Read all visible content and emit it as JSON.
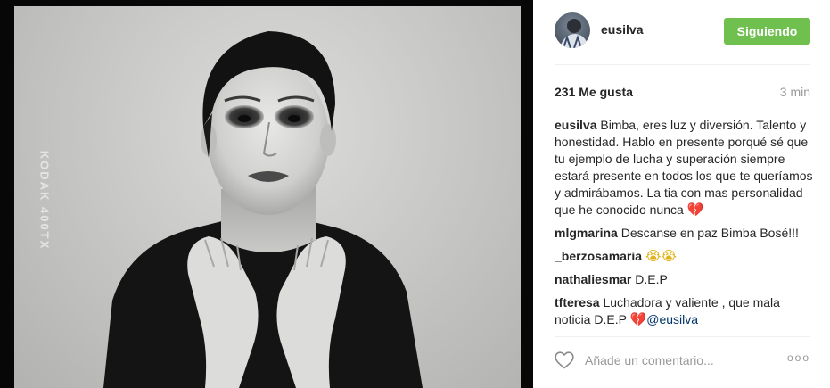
{
  "photo": {
    "film_edge_text": "KODAK 400TX"
  },
  "post": {
    "username": "eusilva",
    "follow_label": "Siguiendo",
    "likes": "231 Me gusta",
    "time": "3 min",
    "caption": {
      "user": "eusilva",
      "text": "Bimba, eres luz y diversión. Talento y honestidad. Hablo en presente porqué sé que tu ejemplo de lucha y superación siempre estará presente en todos los que te queríamos y admirábamos. La tia con mas personalidad que he conocido nunca",
      "emoji": "💔",
      "emoji_icon": "broken-heart-icon"
    },
    "comments": [
      {
        "user": "mlgmarina",
        "text": "Descanse en paz Bimba Bosé!!!"
      },
      {
        "user": "_berzosamaria",
        "text": "",
        "emoji": "😭😭",
        "emoji_icon": "loudly-crying-face-icon"
      },
      {
        "user": "nathaliesmar",
        "text": "D.E.P"
      },
      {
        "user": "tfteresa",
        "text": "Luchadora y valiente , que mala noticia D.E.P",
        "emoji": "💔",
        "mention": "@eusilva"
      }
    ],
    "comment_placeholder": "Añade un comentario...",
    "more_label": "ooo"
  },
  "colors": {
    "follow_button": "#70c050",
    "muted_text": "#999999",
    "mention": "#003569",
    "photo_border": "#070707"
  }
}
